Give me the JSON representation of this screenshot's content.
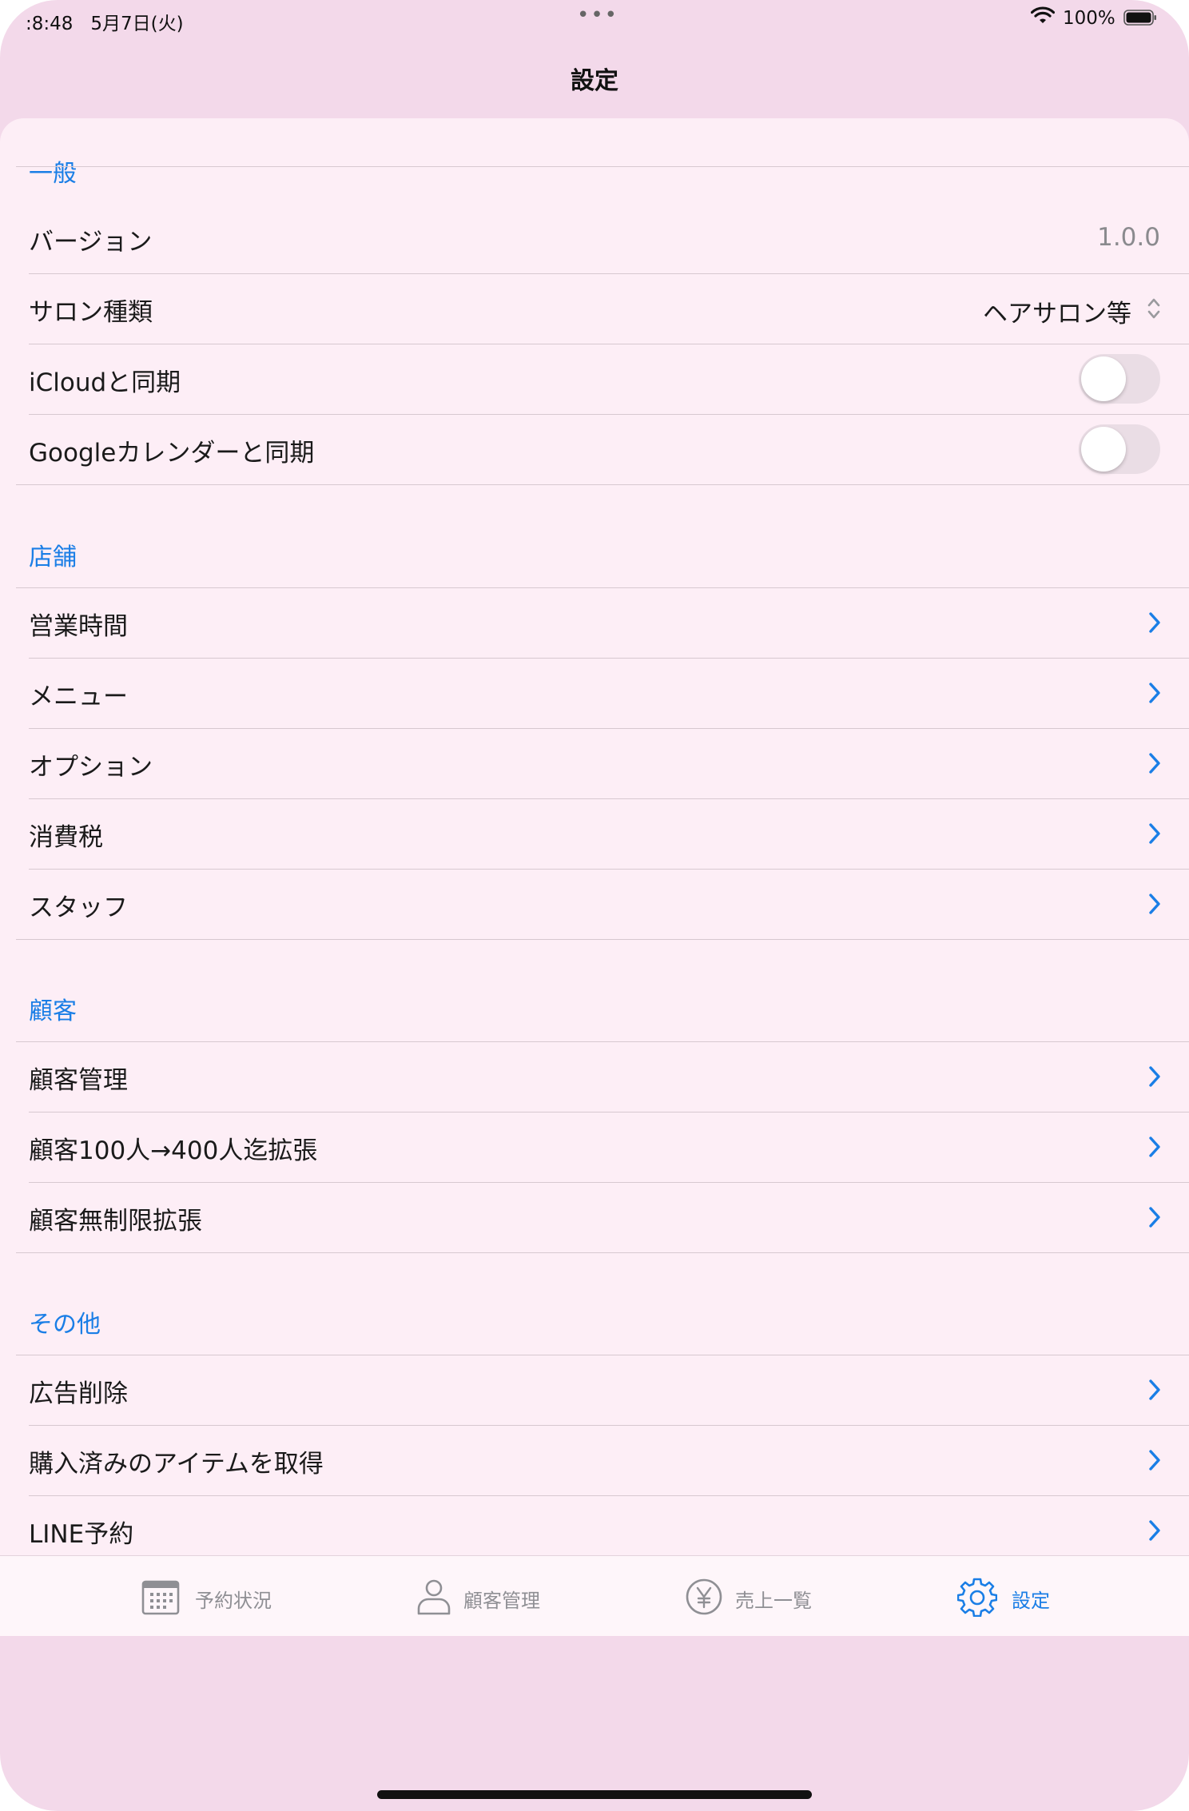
{
  "status_bar": {
    "time": ":8:48",
    "date": "5月7日(火)",
    "dots": "•••",
    "battery": "100%"
  },
  "nav": {
    "title": "設定"
  },
  "sections": {
    "general": {
      "header": "一般",
      "version_label": "バージョン",
      "version_value": "1.0.0",
      "salon_label": "サロン種類",
      "salon_value": "ヘアサロン等",
      "icloud_label": "iCloudと同期",
      "icloud_on": false,
      "google_label": "Googleカレンダーと同期",
      "google_on": false
    },
    "store": {
      "header": "店舗",
      "items": [
        "営業時間",
        "メニュー",
        "オプション",
        "消費税",
        "スタッフ"
      ]
    },
    "customer": {
      "header": "顧客",
      "items": [
        "顧客管理",
        "顧客100人→400人迄拡張",
        "顧客無制限拡張"
      ]
    },
    "other": {
      "header": "その他",
      "items": [
        "広告削除",
        "購入済みのアイテムを取得",
        "LINE予約"
      ]
    }
  },
  "tabs": [
    {
      "label": "予約状況",
      "icon": "calendar-icon"
    },
    {
      "label": "顧客管理",
      "icon": "person-icon"
    },
    {
      "label": "売上一覧",
      "icon": "yen-icon"
    },
    {
      "label": "設定",
      "icon": "gear-icon"
    }
  ],
  "colors": {
    "accent": "#1a7ee6",
    "background": "#f3d9ea",
    "list_background": "#fdeef6"
  }
}
